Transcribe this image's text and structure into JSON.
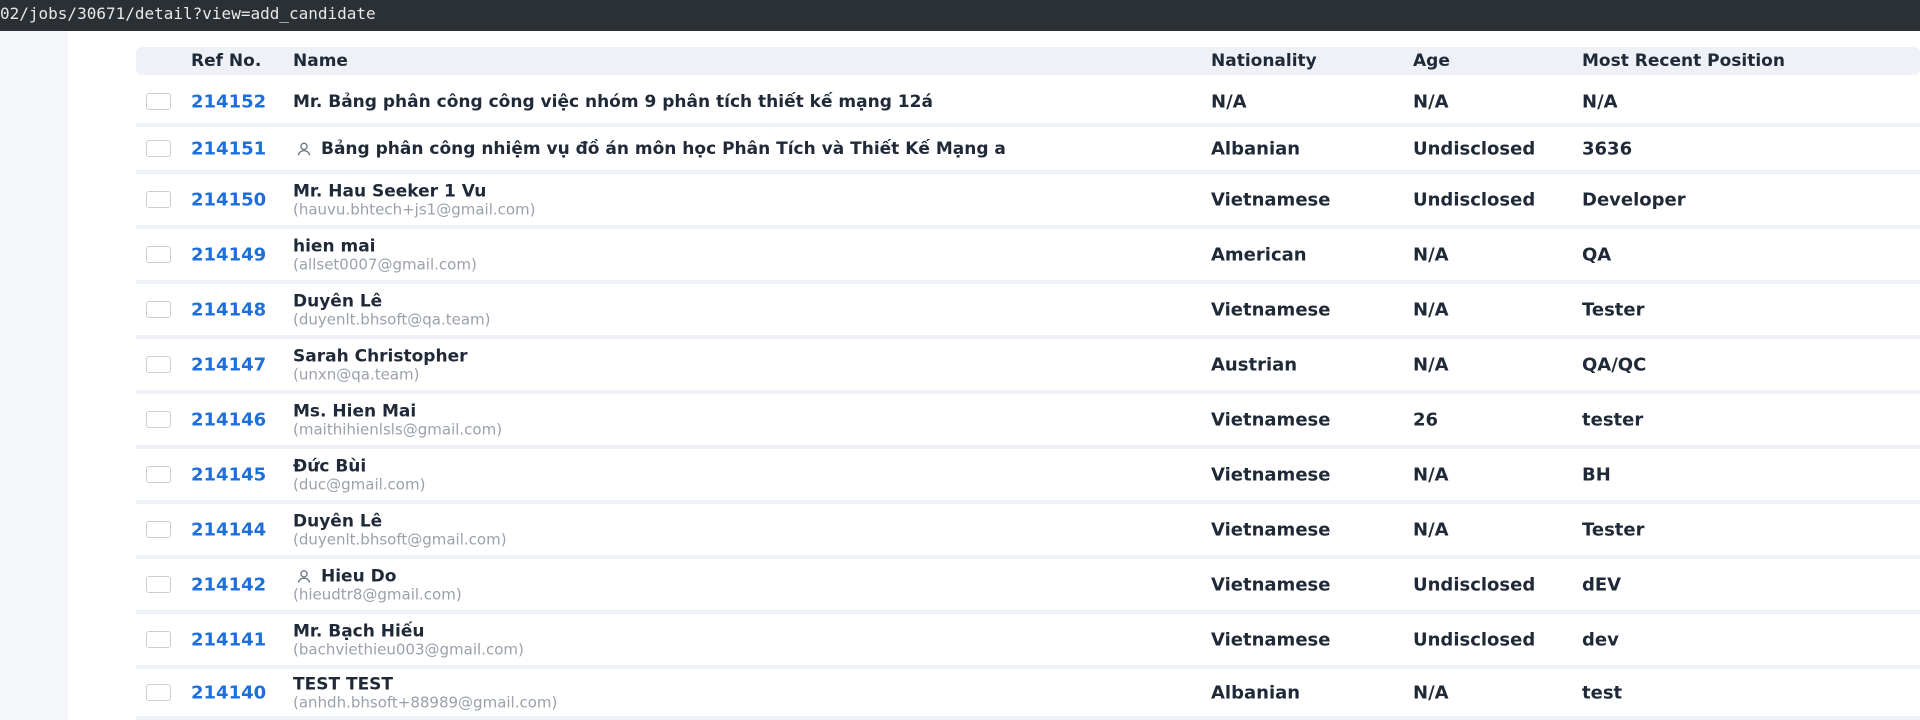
{
  "browser": {
    "url": "02/jobs/30671/detail?view=add_candidate"
  },
  "table": {
    "columns": [
      "Ref No.",
      "Name",
      "Nationality",
      "Age",
      "Most Recent Position"
    ],
    "rows": [
      {
        "ref": "214152",
        "name": "Mr. Bảng phân công công việc nhóm 9 phân tích thiết kế mạng 12á",
        "email": "",
        "icon": "",
        "nationality": "N/A",
        "age": "N/A",
        "position": "N/A"
      },
      {
        "ref": "214151",
        "name": "Bảng phân công nhiệm vụ đồ án môn học Phân Tích và Thiết Kế Mạng a",
        "email": "",
        "icon": "person-icon",
        "nationality": "Albanian",
        "age": "Undisclosed",
        "position": "3636"
      },
      {
        "ref": "214150",
        "name": "Mr. Hau Seeker 1 Vu",
        "email": "(hauvu.bhtech+js1@gmail.com)",
        "icon": "",
        "nationality": "Vietnamese",
        "age": "Undisclosed",
        "position": "Developer"
      },
      {
        "ref": "214149",
        "name": "hien mai",
        "email": "(allset0007@gmail.com)",
        "icon": "",
        "nationality": "American",
        "age": "N/A",
        "position": "QA"
      },
      {
        "ref": "214148",
        "name": "Duyên Lê",
        "email": "(duyenlt.bhsoft@qa.team)",
        "icon": "",
        "nationality": "Vietnamese",
        "age": "N/A",
        "position": "Tester"
      },
      {
        "ref": "214147",
        "name": "Sarah Christopher",
        "email": "(unxn@qa.team)",
        "icon": "",
        "nationality": "Austrian",
        "age": "N/A",
        "position": "QA/QC"
      },
      {
        "ref": "214146",
        "name": "Ms. Hien Mai",
        "email": "(maithihienlsls@gmail.com)",
        "icon": "",
        "nationality": "Vietnamese",
        "age": "26",
        "position": "tester"
      },
      {
        "ref": "214145",
        "name": "Đức Bùi",
        "email": "(duc@gmail.com)",
        "icon": "",
        "nationality": "Vietnamese",
        "age": "N/A",
        "position": "BH"
      },
      {
        "ref": "214144",
        "name": "Duyên Lê",
        "email": "(duyenlt.bhsoft@gmail.com)",
        "icon": "",
        "nationality": "Vietnamese",
        "age": "N/A",
        "position": "Tester"
      },
      {
        "ref": "214142",
        "name": "Hieu Do",
        "email": "(hieudtr8@gmail.com)",
        "icon": "person-icon",
        "nationality": "Vietnamese",
        "age": "Undisclosed",
        "position": "dEV"
      },
      {
        "ref": "214141",
        "name": "Mr. Bạch Hiếu",
        "email": "(bachviethieu003@gmail.com)",
        "icon": "",
        "nationality": "Vietnamese",
        "age": "Undisclosed",
        "position": "dev"
      },
      {
        "ref": "214140",
        "name": "TEST TEST",
        "email": "(anhdh.bhsoft+88989@gmail.com)",
        "icon": "",
        "nationality": "Albanian",
        "age": "N/A",
        "position": "test"
      }
    ]
  },
  "colors": {
    "ref_link": "#1e6fd9",
    "header_bg": "#eef2f7",
    "url_bar_bg": "#2b3035"
  }
}
